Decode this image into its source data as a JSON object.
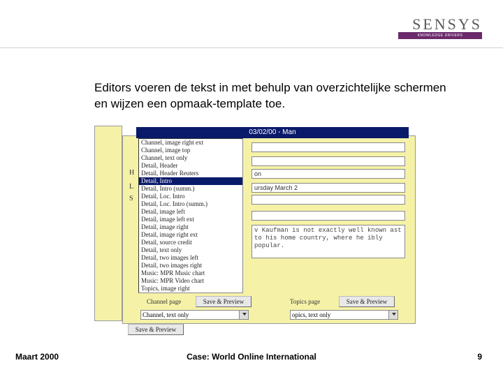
{
  "logo": {
    "name": "SENSYS",
    "tagline": "KNOWLEDGE DRIVERS"
  },
  "headline": "Editors voeren de tekst in met behulp van overzichtelijke schermen en wijzen een opmaak-template toe.",
  "window": {
    "title": "03/02/00 - Man",
    "labels": {
      "h": "H",
      "l": "L",
      "s": "S"
    },
    "field_on": "on",
    "field_date": "ursday March 2",
    "textarea": "v Kaufman is not exactly well known\nast to his home country, where he\nibly popular.",
    "channel_label": "Channel page",
    "topics_label": "Topics page",
    "save_preview": "Save & Preview",
    "channel_value": "Channel, text only",
    "topics_value": "opics, text only"
  },
  "list": [
    "Channel, image right ext",
    "Channel, image top",
    "Channel, text only",
    "Detail, Header",
    "Detail, Header Reuters",
    "Detail, Intro",
    "Detail, Intro (summ.)",
    "Detail, Loc. Intro",
    "Detail, Loc. Intro (summ.)",
    "Detail, image left",
    "Detail, image left ext",
    "Detail, image right",
    "Detail, image right ext",
    "Detail, source credit",
    "Detail, text only",
    "Detail, two images left",
    "Detail, two images right",
    "Music: MPR Music chart",
    "Music: MPR Video chart",
    "Topics, image right"
  ],
  "list_selected_index": 5,
  "footer": {
    "left": "Maart 2000",
    "center": "Case: World Online International",
    "right": "9"
  }
}
